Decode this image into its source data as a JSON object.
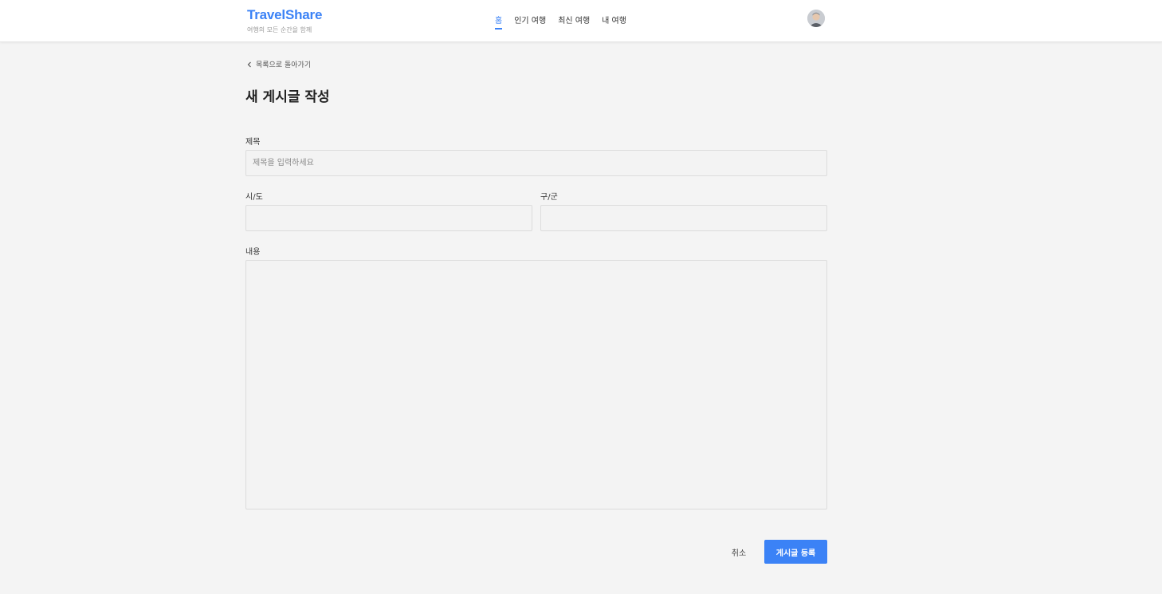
{
  "header": {
    "brand_name": "TravelShare",
    "brand_tagline": "여행의 모든 순간을 함께",
    "nav": [
      {
        "label": "홈",
        "active": true
      },
      {
        "label": "인기 여행",
        "active": false
      },
      {
        "label": "최신 여행",
        "active": false
      },
      {
        "label": "내 여행",
        "active": false
      }
    ]
  },
  "back_link": {
    "label": "목록으로 돌아가기"
  },
  "page_title": "새 게시글 작성",
  "form": {
    "title": {
      "label": "제목",
      "placeholder": "제목을 입력하세요",
      "value": ""
    },
    "city": {
      "label": "시/도",
      "value": ""
    },
    "district": {
      "label": "구/군",
      "value": ""
    },
    "content": {
      "label": "내용",
      "value": ""
    }
  },
  "actions": {
    "cancel_label": "취소",
    "submit_label": "게시글 등록"
  },
  "colors": {
    "accent": "#3b82f6",
    "background": "#f4f4f4",
    "header": "#ffffff"
  }
}
